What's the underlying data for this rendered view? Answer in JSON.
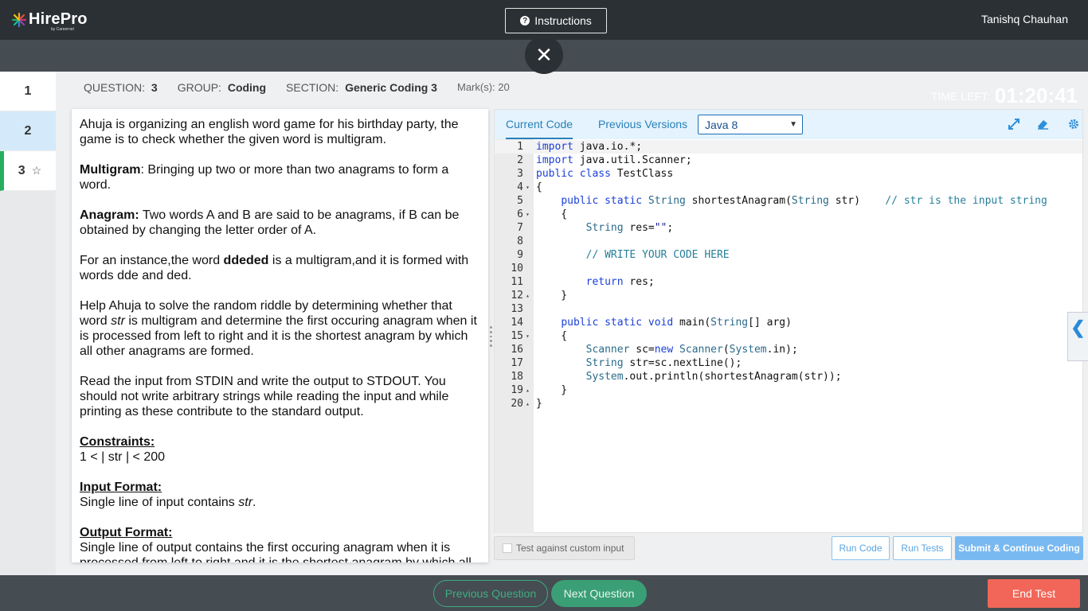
{
  "header": {
    "logo_text": "HirePro",
    "logo_sub": "by Careernet",
    "instructions_label": "Instructions",
    "user_name": "Tanishq Chauhan"
  },
  "timer": {
    "label": "TIME LEFT:",
    "value": "01:20:41"
  },
  "sidebar": {
    "questions": [
      {
        "number": "1",
        "state": "unvisited"
      },
      {
        "number": "2",
        "state": "visited"
      },
      {
        "number": "3",
        "state": "current"
      }
    ]
  },
  "meta": {
    "question_label": "QUESTION:",
    "question_value": "3",
    "group_label": "GROUP:",
    "group_value": "Coding",
    "section_label": "SECTION:",
    "section_value": "Generic Coding 3",
    "marks_label": "Mark(s):",
    "marks_value": "20"
  },
  "question": {
    "intro": "Ahuja is organizing an english word game for his birthday party, the game is to check whether the given word is multigram.",
    "multigram_term": "Multigram",
    "multigram_def": ": Bringing up two or more than two anagrams to form a word.",
    "anagram_term": "Anagram:",
    "anagram_def": " Two words A and B are said to be anagrams, if B can be obtained by changing the letter order of A.",
    "example_pre": "For an instance,the word ",
    "example_word": "ddeded",
    "example_post": " is a multigram,and it is formed with words dde and ded.",
    "task_pre": "Help Ahuja to solve the random riddle by determining whether that word ",
    "task_var": "str",
    "task_post": " is multigram and determine the first occuring anagram when it is processed from left to right and it is the shortest anagram by which all other anagrams are formed.",
    "io_note": "Read the input from STDIN and write the output to STDOUT. You should not write arbitrary strings while reading the input and while printing as these contribute to the standard output.",
    "constraints_heading": "Constraints:",
    "constraints_text": "1 < | str | < 200",
    "input_heading": "Input Format:",
    "input_pre": "Single line of input contains ",
    "input_var": "str",
    "input_post": ".",
    "output_heading": "Output Format:",
    "output_text": "Single line of output contains the first occuring anagram when it is processed from left to right and it is the shortest anagram by which all"
  },
  "editor": {
    "tab_current": "Current Code",
    "tab_previous": "Previous Versions",
    "language": "Java 8",
    "icons": [
      "expand-icon",
      "eraser-icon",
      "settings-icon"
    ],
    "lines": [
      {
        "n": "1",
        "fold": ""
      },
      {
        "n": "2",
        "fold": ""
      },
      {
        "n": "3",
        "fold": ""
      },
      {
        "n": "4",
        "fold": "▾"
      },
      {
        "n": "5",
        "fold": ""
      },
      {
        "n": "6",
        "fold": "▾"
      },
      {
        "n": "7",
        "fold": ""
      },
      {
        "n": "8",
        "fold": ""
      },
      {
        "n": "9",
        "fold": ""
      },
      {
        "n": "10",
        "fold": ""
      },
      {
        "n": "11",
        "fold": ""
      },
      {
        "n": "12",
        "fold": "▴"
      },
      {
        "n": "13",
        "fold": ""
      },
      {
        "n": "14",
        "fold": ""
      },
      {
        "n": "15",
        "fold": "▾"
      },
      {
        "n": "16",
        "fold": ""
      },
      {
        "n": "17",
        "fold": ""
      },
      {
        "n": "18",
        "fold": ""
      },
      {
        "n": "19",
        "fold": "▴"
      },
      {
        "n": "20",
        "fold": "▴"
      }
    ],
    "code": {
      "l1_kw": "import",
      "l1_rest": " java.io.*;",
      "l2_kw": "import",
      "l2_rest": " java.util.Scanner;",
      "l3_kw": "public class",
      "l3_rest": " TestClass",
      "l4": "{",
      "l5_indent": "    ",
      "l5_kw": "public static",
      "l5_sp": " ",
      "l5_ty": "String",
      "l5_mid": " shortestAnagram(",
      "l5_ty2": "String",
      "l5_end": " str)    ",
      "l5_cm": "// str is the input string",
      "l6": "    {",
      "l7_indent": "        ",
      "l7_ty": "String",
      "l7_mid": " res=",
      "l7_str": "\"\"",
      "l7_end": ";",
      "l8": "",
      "l9_indent": "        ",
      "l9_cm": "// WRITE YOUR CODE HERE",
      "l10": "",
      "l11_indent": "        ",
      "l11_kw": "return",
      "l11_end": " res;",
      "l12": "    }",
      "l13": "",
      "l14_indent": "    ",
      "l14_kw": "public static void",
      "l14_mid": " main(",
      "l14_ty": "String",
      "l14_end": "[] arg)",
      "l15": "    {",
      "l16_indent": "        ",
      "l16_ty": "Scanner",
      "l16_mid": " sc=",
      "l16_kw": "new",
      "l16_sp": " ",
      "l16_ty2": "Scanner",
      "l16_p": "(",
      "l16_ty3": "System",
      "l16_end": ".in);",
      "l17_indent": "        ",
      "l17_ty": "String",
      "l17_end": " str=sc.nextLine();",
      "l18_indent": "        ",
      "l18_ty": "System",
      "l18_end": ".out.println(shortestAnagram(str));",
      "l19": "    }",
      "l20": "}"
    }
  },
  "footer": {
    "custom_input_label": "Test against custom input",
    "run_code": "Run Code",
    "run_tests": "Run Tests",
    "submit": "Submit & Continue Coding"
  },
  "nav": {
    "previous": "Previous Question",
    "next": "Next Question",
    "end": "End Test"
  }
}
